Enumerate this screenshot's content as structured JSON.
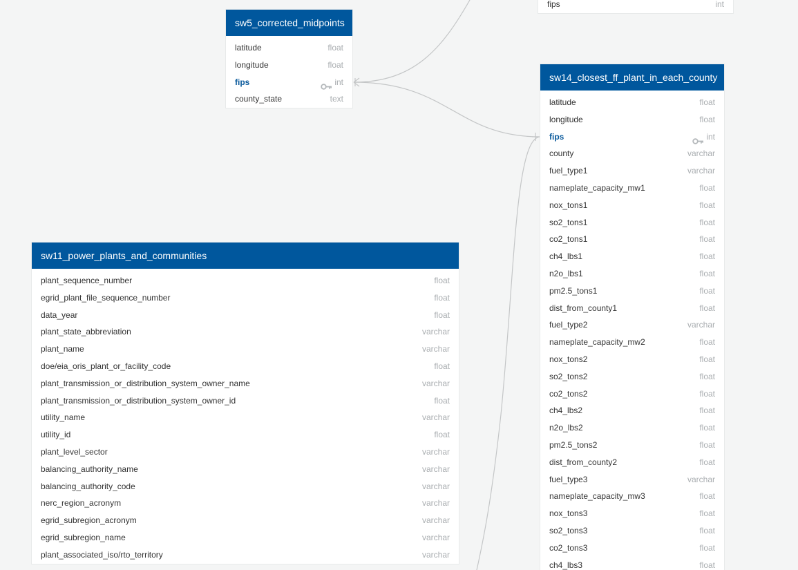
{
  "tables": {
    "top": {
      "columns": [
        {
          "name": "fips",
          "type": "int",
          "pk": false
        }
      ]
    },
    "sw5": {
      "name": "sw5_corrected_midpoints",
      "columns": [
        {
          "name": "latitude",
          "type": "float",
          "pk": false
        },
        {
          "name": "longitude",
          "type": "float",
          "pk": false
        },
        {
          "name": "fips",
          "type": "int",
          "pk": true
        },
        {
          "name": "county_state",
          "type": "text",
          "pk": false
        }
      ]
    },
    "sw14": {
      "name": "sw14_closest_ff_plant_in_each_county",
      "columns": [
        {
          "name": "latitude",
          "type": "float",
          "pk": false
        },
        {
          "name": "longitude",
          "type": "float",
          "pk": false
        },
        {
          "name": "fips",
          "type": "int",
          "pk": true
        },
        {
          "name": "county",
          "type": "varchar",
          "pk": false
        },
        {
          "name": "fuel_type1",
          "type": "varchar",
          "pk": false
        },
        {
          "name": "nameplate_capacity_mw1",
          "type": "float",
          "pk": false
        },
        {
          "name": "nox_tons1",
          "type": "float",
          "pk": false
        },
        {
          "name": "so2_tons1",
          "type": "float",
          "pk": false
        },
        {
          "name": "co2_tons1",
          "type": "float",
          "pk": false
        },
        {
          "name": "ch4_lbs1",
          "type": "float",
          "pk": false
        },
        {
          "name": "n2o_lbs1",
          "type": "float",
          "pk": false
        },
        {
          "name": "pm2.5_tons1",
          "type": "float",
          "pk": false
        },
        {
          "name": "dist_from_county1",
          "type": "float",
          "pk": false
        },
        {
          "name": "fuel_type2",
          "type": "varchar",
          "pk": false
        },
        {
          "name": "nameplate_capacity_mw2",
          "type": "float",
          "pk": false
        },
        {
          "name": "nox_tons2",
          "type": "float",
          "pk": false
        },
        {
          "name": "so2_tons2",
          "type": "float",
          "pk": false
        },
        {
          "name": "co2_tons2",
          "type": "float",
          "pk": false
        },
        {
          "name": "ch4_lbs2",
          "type": "float",
          "pk": false
        },
        {
          "name": "n2o_lbs2",
          "type": "float",
          "pk": false
        },
        {
          "name": "pm2.5_tons2",
          "type": "float",
          "pk": false
        },
        {
          "name": "dist_from_county2",
          "type": "float",
          "pk": false
        },
        {
          "name": "fuel_type3",
          "type": "varchar",
          "pk": false
        },
        {
          "name": "nameplate_capacity_mw3",
          "type": "float",
          "pk": false
        },
        {
          "name": "nox_tons3",
          "type": "float",
          "pk": false
        },
        {
          "name": "so2_tons3",
          "type": "float",
          "pk": false
        },
        {
          "name": "co2_tons3",
          "type": "float",
          "pk": false
        },
        {
          "name": "ch4_lbs3",
          "type": "float",
          "pk": false
        }
      ]
    },
    "sw11": {
      "name": "sw11_power_plants_and_communities",
      "columns": [
        {
          "name": "plant_sequence_number",
          "type": "float",
          "pk": false
        },
        {
          "name": "egrid_plant_file_sequence_number",
          "type": "float",
          "pk": false
        },
        {
          "name": "data_year",
          "type": "float",
          "pk": false
        },
        {
          "name": "plant_state_abbreviation",
          "type": "varchar",
          "pk": false
        },
        {
          "name": "plant_name",
          "type": "varchar",
          "pk": false
        },
        {
          "name": "doe/eia_oris_plant_or_facility_code",
          "type": "float",
          "pk": false
        },
        {
          "name": "plant_transmission_or_distribution_system_owner_name",
          "type": "varchar",
          "pk": false
        },
        {
          "name": "plant_transmission_or_distribution_system_owner_id",
          "type": "float",
          "pk": false
        },
        {
          "name": "utility_name",
          "type": "varchar",
          "pk": false
        },
        {
          "name": "utility_id",
          "type": "float",
          "pk": false
        },
        {
          "name": "plant_level_sector",
          "type": "varchar",
          "pk": false
        },
        {
          "name": "balancing_authority_name",
          "type": "varchar",
          "pk": false
        },
        {
          "name": "balancing_authority_code",
          "type": "varchar",
          "pk": false
        },
        {
          "name": "nerc_region_acronym",
          "type": "varchar",
          "pk": false
        },
        {
          "name": "egrid_subregion_acronym",
          "type": "varchar",
          "pk": false
        },
        {
          "name": "egrid_subregion_name",
          "type": "varchar",
          "pk": false
        },
        {
          "name": "plant_associated_iso/rto_territory",
          "type": "varchar",
          "pk": false
        }
      ]
    }
  },
  "colors": {
    "header_bg": "#00579d",
    "header_text": "#ffffff",
    "canvas_bg": "#f4f5f5",
    "type_text": "#a9adb0",
    "pk_text": "#0a5a9c",
    "connector": "#c4c6c7"
  },
  "icons": {
    "primary_key": "key-icon"
  }
}
